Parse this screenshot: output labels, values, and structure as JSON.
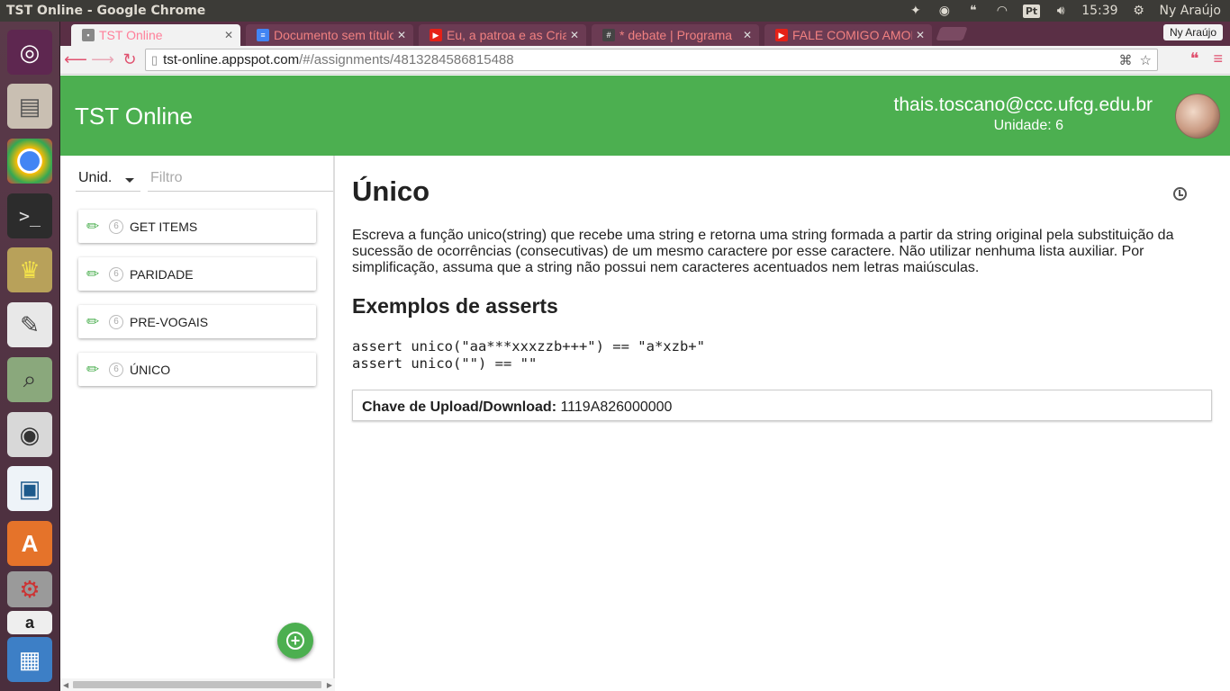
{
  "os_panel": {
    "window_title": "TST Online - Google Chrome",
    "time": "15:39",
    "user": "Ny Araújo",
    "keyboard": "Pt"
  },
  "launcher": {
    "items": [
      {
        "name": "ubuntu-dash-icon"
      },
      {
        "name": "files-icon"
      },
      {
        "name": "chrome-icon"
      },
      {
        "name": "terminal-icon"
      },
      {
        "name": "genie-icon"
      },
      {
        "name": "text-editor-icon"
      },
      {
        "name": "image-viewer-icon"
      },
      {
        "name": "speaker-icon"
      },
      {
        "name": "libreoffice-draw-icon"
      },
      {
        "name": "software-center-icon"
      },
      {
        "name": "settings-icon"
      },
      {
        "name": "amazon-icon"
      },
      {
        "name": "workspace-icon"
      }
    ]
  },
  "browser": {
    "tabs": [
      {
        "title": "TST Online",
        "active": true,
        "fav_color": "#888888"
      },
      {
        "title": "Documento sem título",
        "active": false,
        "fav_color": "#4285f4"
      },
      {
        "title": "Eu, a patroa e as Crianças",
        "active": false,
        "fav_color": "#e62117"
      },
      {
        "title": "* debate | Programa",
        "active": false,
        "fav_color": "#444444"
      },
      {
        "title": "FALE COMIGO AMOR",
        "active": false,
        "fav_color": "#e62117"
      }
    ],
    "profile": "Ny Araújo",
    "url_host": "tst-online.appspot.com",
    "url_path": "/#/assignments/4813284586815488"
  },
  "app": {
    "title": "TST Online",
    "user_email": "thais.toscano@ccc.ufcg.edu.br",
    "user_unit": "Unidade: 6",
    "accent": "#4caf50"
  },
  "sidebar": {
    "unit_select": "Unid.",
    "filter_placeholder": "Filtro",
    "assignments": [
      {
        "name": "GET ITEMS",
        "unit": "6"
      },
      {
        "name": "PARIDADE",
        "unit": "6"
      },
      {
        "name": "PRE-VOGAIS",
        "unit": "6"
      },
      {
        "name": "ÚNICO",
        "unit": "6"
      }
    ]
  },
  "assignment": {
    "title": "Único",
    "description": "Escreva a função unico(string) que recebe uma string e retorna uma string formada a partir da string original pela substituição da sucessão de ocorrências (consecutivas) de um mesmo caractere por esse caractere. Não utilizar nenhuma lista auxiliar. Por simplificação, assuma que a string não possui nem caracteres acentuados nem letras maiúsculas.",
    "examples_heading": "Exemplos de asserts",
    "code_line_1": "assert unico(\"aa***xxxzzb+++\") == \"a*xzb+\"",
    "code_line_2": "assert unico(\"\") == \"\"",
    "key_label": "Chave de Upload/Download:",
    "key_value": "1119A826000000"
  }
}
